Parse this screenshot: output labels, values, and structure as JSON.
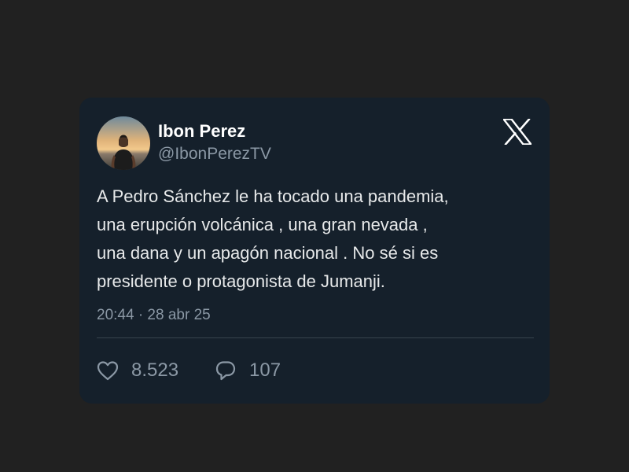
{
  "tweet": {
    "author": {
      "name": "Ibon Perez",
      "handle": "@IbonPerezTV"
    },
    "text_lines": [
      "A Pedro Sánchez le ha tocado una pandemia,",
      "una erupción volcánica , una gran nevada ,",
      "una dana y un apagón nacional . No sé si es",
      "presidente o protagonista de Jumanji."
    ],
    "timestamp": "20:44 · 28 abr 25",
    "stats": {
      "likes": "8.523",
      "replies": "107"
    }
  },
  "icons": {
    "platform": "x-logo-icon",
    "like": "heart-icon",
    "reply": "reply-bubble-icon"
  },
  "colors": {
    "page_background": "#212121",
    "card_background": "#15202b",
    "primary_text": "#e7e9ea",
    "secondary_text": "#8b98a5",
    "divider": "#38444d"
  }
}
